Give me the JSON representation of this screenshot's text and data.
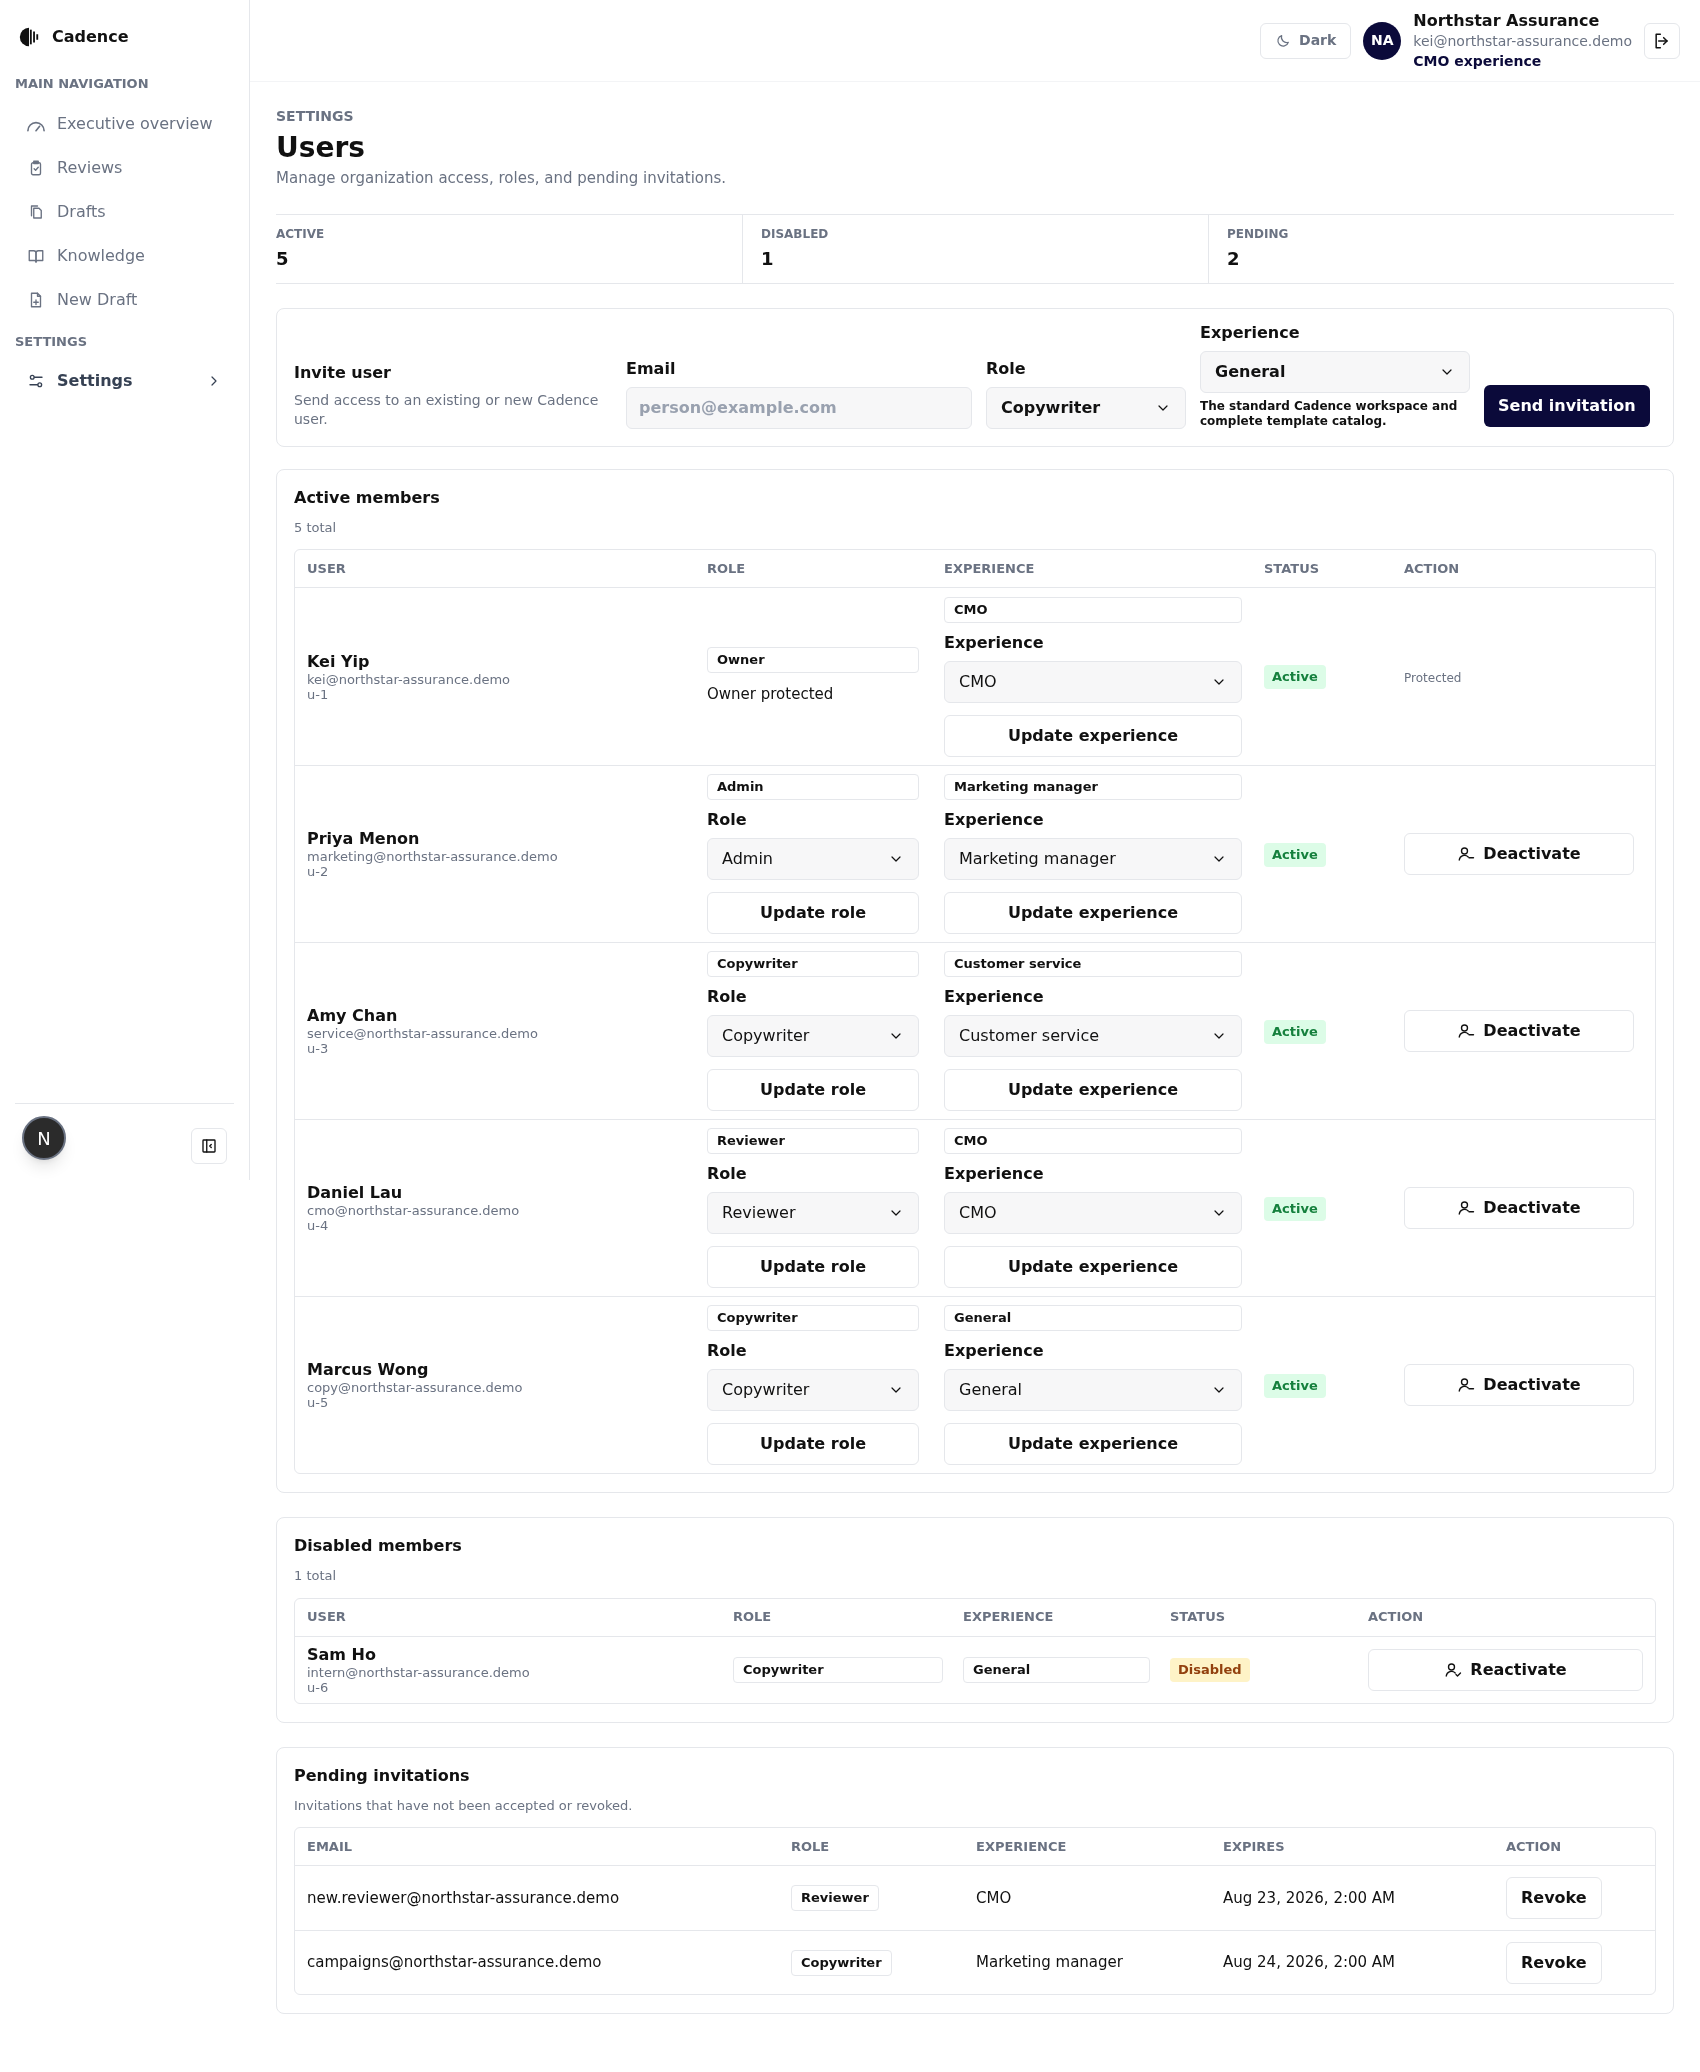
{
  "sidebar": {
    "brand": "Cadence",
    "sections": [
      {
        "heading": "MAIN NAVIGATION",
        "items": [
          {
            "label": "Executive overview",
            "selected": false
          },
          {
            "label": "Reviews",
            "selected": false
          },
          {
            "label": "Drafts",
            "selected": false
          },
          {
            "label": "Knowledge",
            "selected": false
          },
          {
            "label": "New Draft",
            "selected": false
          }
        ]
      },
      {
        "heading": "SETTINGS",
        "items": [
          {
            "label": "Settings",
            "selected": true
          }
        ]
      }
    ],
    "dev_badge": "N"
  },
  "header": {
    "theme_button": "Dark",
    "avatar": "NA",
    "org": "Northstar Assurance",
    "email": "kei@northstar-assurance.demo",
    "experience": "CMO experience"
  },
  "page": {
    "eyebrow": "SETTINGS",
    "title": "Users",
    "subtitle": "Manage organization access, roles, and pending invitations."
  },
  "stats": [
    {
      "label": "ACTIVE",
      "value": "5"
    },
    {
      "label": "DISABLED",
      "value": "1"
    },
    {
      "label": "PENDING",
      "value": "2"
    }
  ],
  "invite": {
    "title": "Invite user",
    "description": "Send access to an existing or new Cadence user.",
    "email_label": "Email",
    "email_placeholder": "person@example.com",
    "role_label": "Role",
    "role_value": "Copywriter",
    "experience_label": "Experience",
    "experience_value": "General",
    "experience_hint": "The standard Cadence workspace and complete template catalog.",
    "button": "Send invitation"
  },
  "active_members": {
    "title": "Active members",
    "count": "5 total",
    "columns": [
      "USER",
      "ROLE",
      "EXPERIENCE",
      "STATUS",
      "ACTION"
    ],
    "rows": [
      {
        "kind": "owner",
        "name": "Kei Yip",
        "email": "kei@northstar-assurance.demo",
        "id": "u-1",
        "role_badge": "Owner",
        "role_note": "Owner protected",
        "experience_badge": "CMO",
        "experience_label": "Experience",
        "experience_value": "CMO",
        "experience_button": "Update experience",
        "status": "Active",
        "action": "Protected"
      },
      {
        "kind": "editable",
        "name": "Priya Menon",
        "email": "marketing@northstar-assurance.demo",
        "id": "u-2",
        "role_badge": "Admin",
        "role_label": "Role",
        "role_value": "Admin",
        "role_button": "Update role",
        "experience_badge": "Marketing manager",
        "experience_label": "Experience",
        "experience_value": "Marketing manager",
        "experience_button": "Update experience",
        "status": "Active",
        "action": "Deactivate"
      },
      {
        "kind": "editable",
        "name": "Amy Chan",
        "email": "service@northstar-assurance.demo",
        "id": "u-3",
        "role_badge": "Copywriter",
        "role_label": "Role",
        "role_value": "Copywriter",
        "role_button": "Update role",
        "experience_badge": "Customer service",
        "experience_label": "Experience",
        "experience_value": "Customer service",
        "experience_button": "Update experience",
        "status": "Active",
        "action": "Deactivate"
      },
      {
        "kind": "editable",
        "name": "Daniel Lau",
        "email": "cmo@northstar-assurance.demo",
        "id": "u-4",
        "role_badge": "Reviewer",
        "role_label": "Role",
        "role_value": "Reviewer",
        "role_button": "Update role",
        "experience_badge": "CMO",
        "experience_label": "Experience",
        "experience_value": "CMO",
        "experience_button": "Update experience",
        "status": "Active",
        "action": "Deactivate"
      },
      {
        "kind": "editable",
        "name": "Marcus Wong",
        "email": "copy@northstar-assurance.demo",
        "id": "u-5",
        "role_badge": "Copywriter",
        "role_label": "Role",
        "role_value": "Copywriter",
        "role_button": "Update role",
        "experience_badge": "General",
        "experience_label": "Experience",
        "experience_value": "General",
        "experience_button": "Update experience",
        "status": "Active",
        "action": "Deactivate"
      }
    ]
  },
  "disabled_members": {
    "title": "Disabled members",
    "count": "1 total",
    "columns": [
      "USER",
      "ROLE",
      "EXPERIENCE",
      "STATUS",
      "ACTION"
    ],
    "rows": [
      {
        "name": "Sam Ho",
        "email": "intern@northstar-assurance.demo",
        "id": "u-6",
        "role": "Copywriter",
        "experience": "General",
        "status": "Disabled",
        "action": "Reactivate"
      }
    ]
  },
  "pending_invitations": {
    "title": "Pending invitations",
    "description": "Invitations that have not been accepted or revoked.",
    "columns": [
      "EMAIL",
      "ROLE",
      "EXPERIENCE",
      "EXPIRES",
      "ACTION"
    ],
    "rows": [
      {
        "email": "new.reviewer@northstar-assurance.demo",
        "role": "Reviewer",
        "experience": "CMO",
        "expires": "Aug 23, 2026, 2:00 AM",
        "action": "Revoke"
      },
      {
        "email": "campaigns@northstar-assurance.demo",
        "role": "Copywriter",
        "experience": "Marketing manager",
        "expires": "Aug 24, 2026, 2:00 AM",
        "action": "Revoke"
      }
    ]
  }
}
